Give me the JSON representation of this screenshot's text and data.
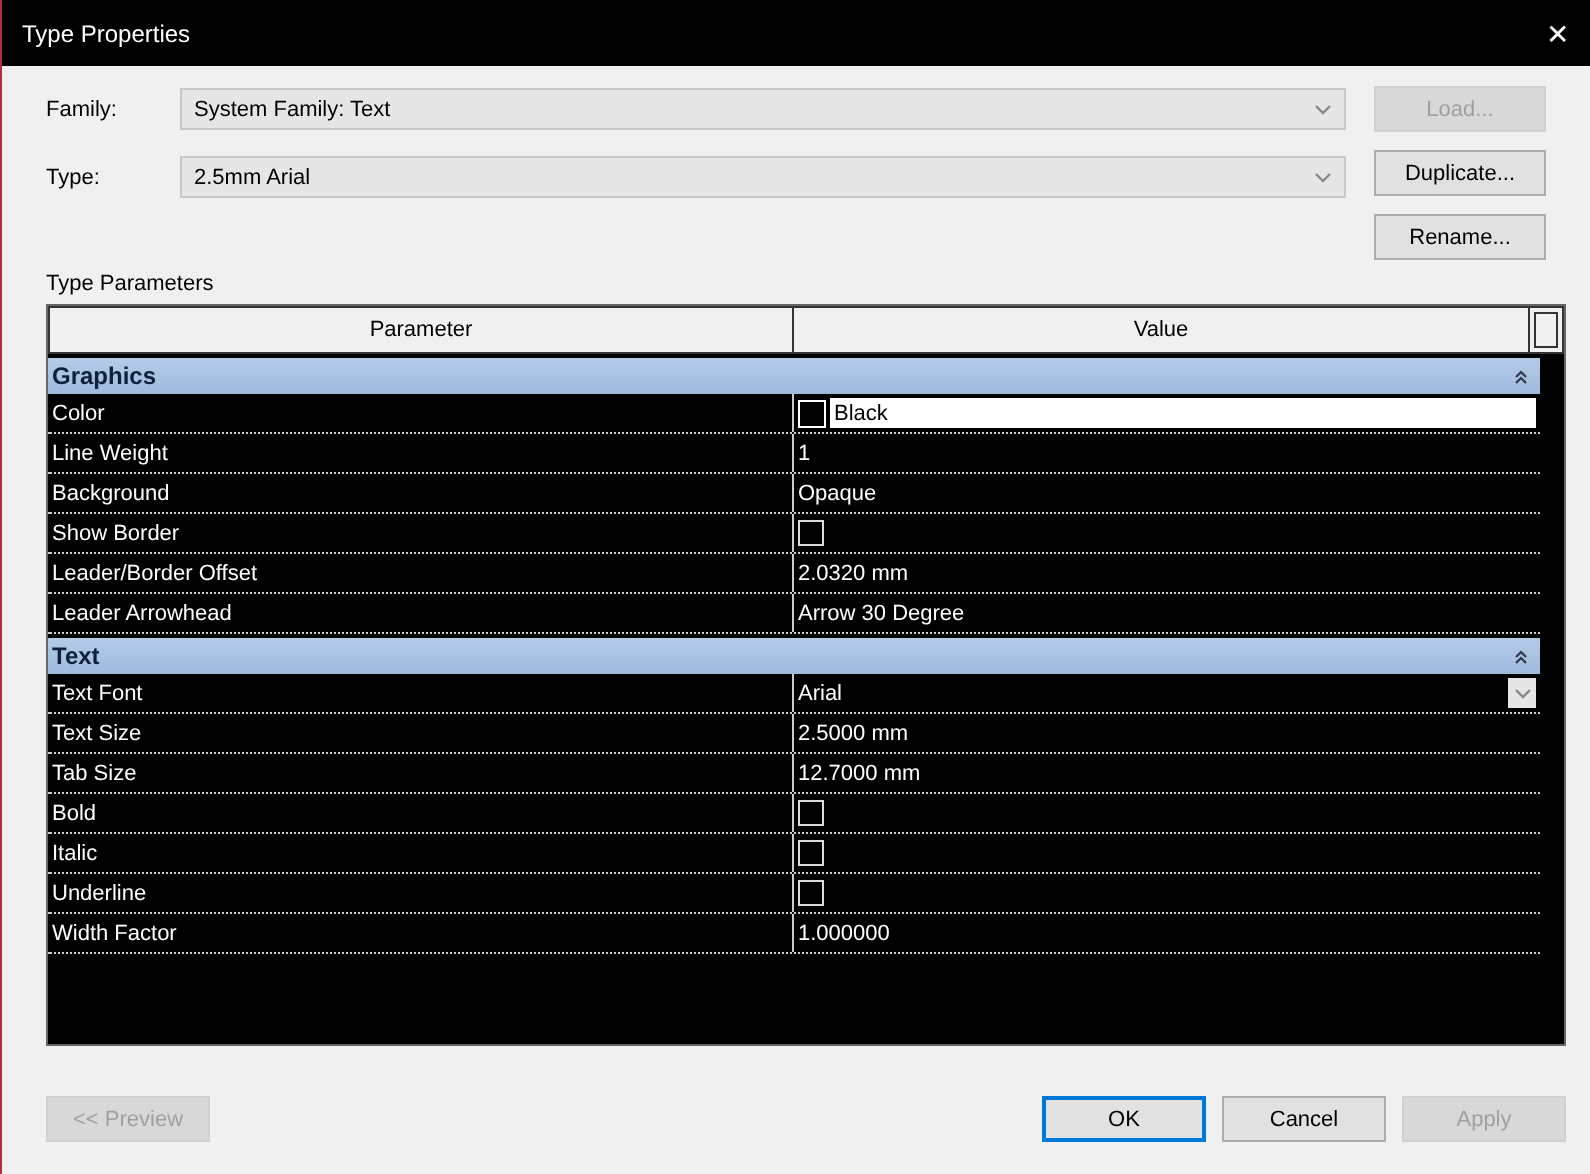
{
  "window": {
    "title": "Type Properties",
    "close": "✕"
  },
  "family": {
    "label": "Family:",
    "value": "System Family: Text"
  },
  "type": {
    "label": "Type:",
    "value": "2.5mm Arial"
  },
  "side_buttons": [
    {
      "label": "Load...",
      "disabled": true
    },
    {
      "label": "Duplicate...",
      "disabled": false
    },
    {
      "label": "Rename...",
      "disabled": false
    }
  ],
  "section_label": "Type Parameters",
  "table": {
    "columns": [
      "Parameter",
      "Value"
    ],
    "groups": [
      {
        "name": "Graphics",
        "expanded": true,
        "rows": [
          {
            "name": "Color",
            "kind": "color",
            "value": "Black"
          },
          {
            "name": "Line Weight",
            "kind": "text",
            "value": "1"
          },
          {
            "name": "Background",
            "kind": "text",
            "value": "Opaque"
          },
          {
            "name": "Show Border",
            "kind": "checkbox",
            "checked": false
          },
          {
            "name": "Leader/Border Offset",
            "kind": "text",
            "value": "2.0320 mm"
          },
          {
            "name": "Leader Arrowhead",
            "kind": "text",
            "value": "Arrow 30 Degree"
          }
        ]
      },
      {
        "name": "Text",
        "expanded": true,
        "rows": [
          {
            "name": "Text Font",
            "kind": "dropdown",
            "value": "Arial"
          },
          {
            "name": "Text Size",
            "kind": "text",
            "value": "2.5000 mm"
          },
          {
            "name": "Tab Size",
            "kind": "text",
            "value": "12.7000 mm"
          },
          {
            "name": "Bold",
            "kind": "checkbox",
            "checked": false
          },
          {
            "name": "Italic",
            "kind": "checkbox",
            "checked": false
          },
          {
            "name": "Underline",
            "kind": "checkbox",
            "checked": false
          },
          {
            "name": "Width Factor",
            "kind": "text",
            "value": "1.000000"
          }
        ]
      }
    ]
  },
  "preview_button": {
    "label": "<< Preview",
    "disabled": true
  },
  "buttons": [
    {
      "label": "OK",
      "disabled": false,
      "default": true
    },
    {
      "label": "Cancel",
      "disabled": false,
      "default": false
    },
    {
      "label": "Apply",
      "disabled": true,
      "default": false
    }
  ]
}
